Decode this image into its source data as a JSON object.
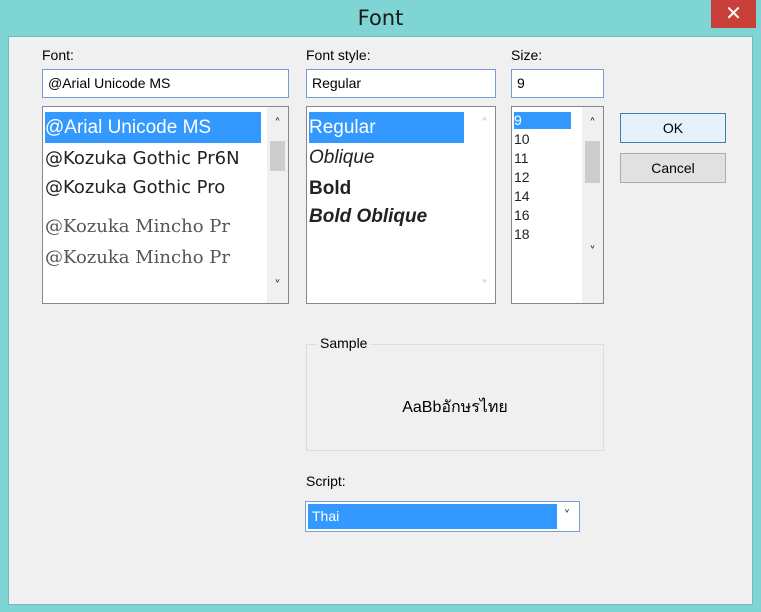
{
  "window": {
    "title": "Font",
    "close_glyph": "✕"
  },
  "font": {
    "label": "Font:",
    "value": "@Arial Unicode MS",
    "items": [
      "@Arial Unicode MS",
      "@Kozuka Gothic Pr6N",
      "@Kozuka Gothic Pro",
      "@Kozuka Mincho Pr",
      "@Kozuka Mincho Pr"
    ]
  },
  "font_style": {
    "label": "Font style:",
    "value": "Regular",
    "items": [
      "Regular",
      "Oblique",
      "Bold",
      "Bold Oblique"
    ]
  },
  "size": {
    "label": "Size:",
    "value": "9",
    "items": [
      "9",
      "10",
      "11",
      "12",
      "14",
      "16",
      "18"
    ]
  },
  "buttons": {
    "ok": "OK",
    "cancel": "Cancel"
  },
  "sample": {
    "label": "Sample",
    "text": "AaBbอักษรไทย"
  },
  "script": {
    "label": "Script:",
    "value": "Thai"
  },
  "icons": {
    "scroll_up": "chevron-up-icon",
    "scroll_down": "chevron-down-icon",
    "dropdown": "chevron-down-icon"
  }
}
